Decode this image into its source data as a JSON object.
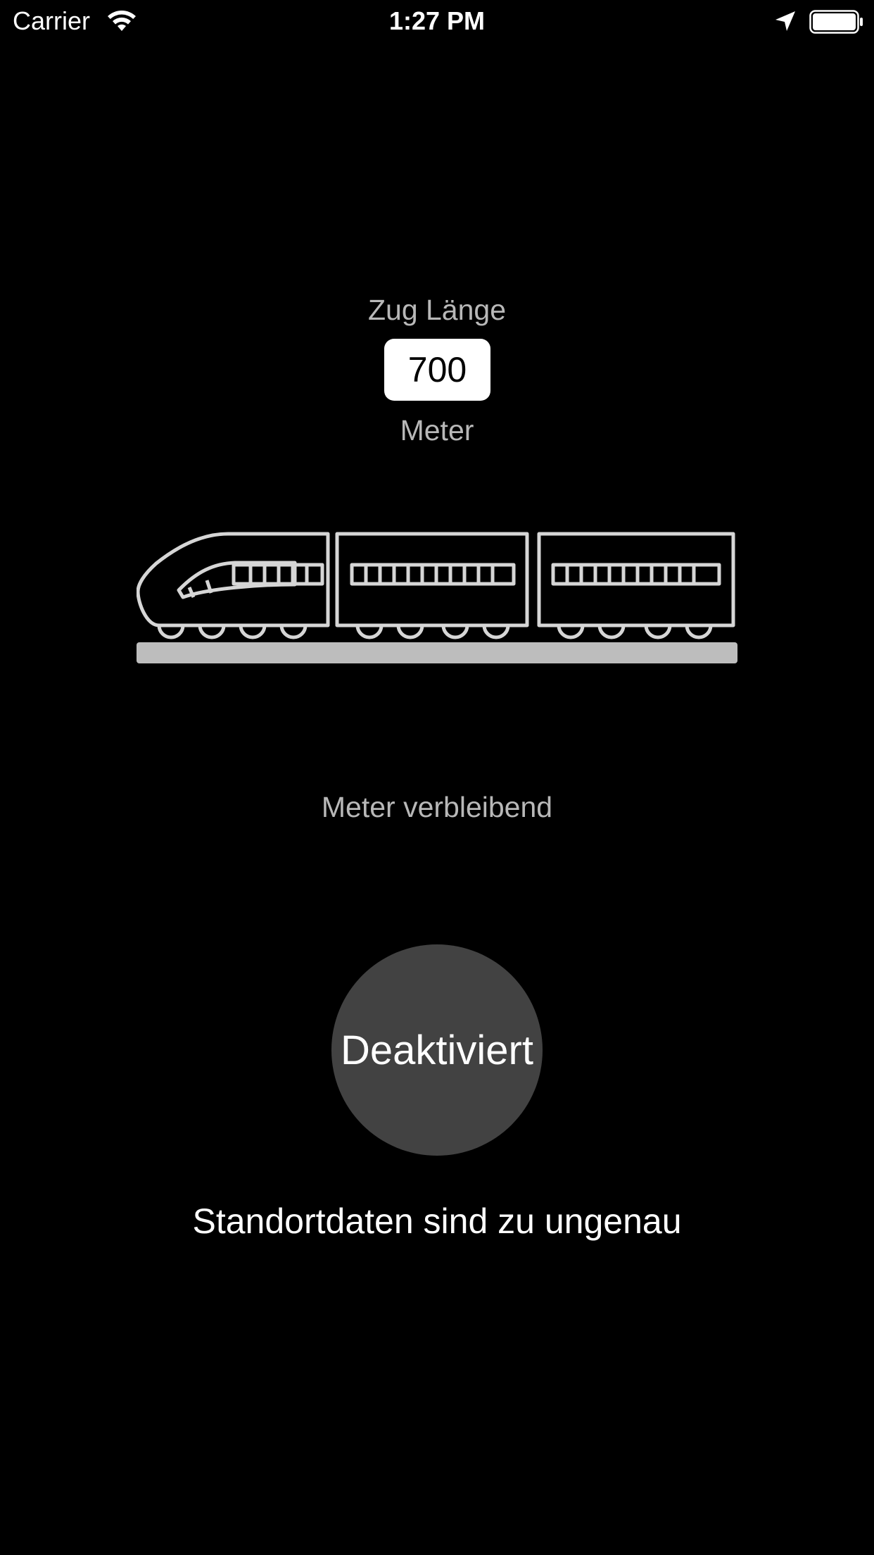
{
  "status_bar": {
    "carrier": "Carrier",
    "time": "1:27 PM",
    "icons": [
      "wifi-icon",
      "location-arrow-icon",
      "battery-icon"
    ]
  },
  "train_length": {
    "title": "Zug Länge",
    "value": "700",
    "unit": "Meter"
  },
  "illustration": {
    "icon": "train-icon",
    "color": "#d6d6d6",
    "track_color": "#bdbdbd"
  },
  "remaining": {
    "label": "Meter verbleibend"
  },
  "toggle": {
    "label": "Deaktiviert",
    "color": "#424242"
  },
  "message": "Standortdaten sind zu ungenau"
}
